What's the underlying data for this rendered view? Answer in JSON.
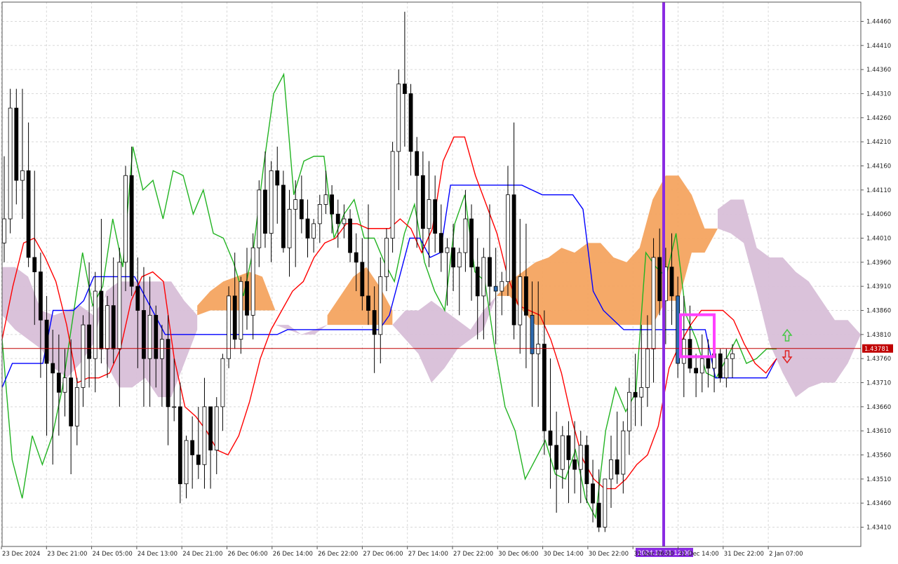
{
  "chart_data": {
    "type": "candlestick",
    "instrument": "",
    "colors": {
      "background": "#ffffff",
      "grid": "#d9d9d9",
      "axis": "#555555",
      "candle_body_bull": "#ffffff",
      "candle_body_bear": "#000000",
      "candle_body_bull_highlight": "#2e6bb0",
      "tenkan": "#ff0000",
      "kijun": "#0000ff",
      "chikou": "#22b322",
      "kumo_bull": "#f4a460",
      "kumo_bear": "#d8bfd8",
      "current_price": "#c00000",
      "vertical_marker": "#8a2be2",
      "highlight_box": "#ff40ff",
      "arrow_up": "#46c846",
      "arrow_down": "#e02020"
    },
    "y_range": [
      1.4337,
      1.445
    ],
    "y_ticks": [
      "1.44460",
      "1.44410",
      "1.44360",
      "1.44310",
      "1.44260",
      "1.44210",
      "1.44160",
      "1.44110",
      "1.44060",
      "1.44010",
      "1.43960",
      "1.43910",
      "1.43860",
      "1.43810",
      "1.43760",
      "1.43710",
      "1.43660",
      "1.43610",
      "1.43560",
      "1.43510",
      "1.43460",
      "1.43410"
    ],
    "x_tick_labels": [
      "23 Dec 2024",
      "23 Dec 21:00",
      "24 Dec 05:00",
      "24 Dec 13:00",
      "24 Dec 21:00",
      "26 Dec 06:00",
      "26 Dec 14:00",
      "26 Dec 22:00",
      "27 Dec 06:00",
      "27 Dec 14:00",
      "27 Dec 22:00",
      "30 Dec 06:00",
      "30 Dec 14:00",
      "30 Dec 22:00",
      "31 Dec 06:00",
      "31 Dec 14:00",
      "31 Dec 22:00",
      "2 Jan 07:00"
    ],
    "current_price_label": "1.43781",
    "current_price": 1.43781,
    "marker_label": "2024.12.31 12:00",
    "candles_ohlc": [
      [
        1.44,
        1.4418,
        1.4396,
        1.4405
      ],
      [
        1.4405,
        1.4432,
        1.4402,
        1.4428
      ],
      [
        1.4428,
        1.4432,
        1.4408,
        1.4413
      ],
      [
        1.4413,
        1.4432,
        1.4405,
        1.4415
      ],
      [
        1.4415,
        1.4425,
        1.4395,
        1.4397
      ],
      [
        1.4397,
        1.4415,
        1.4383,
        1.4394
      ],
      [
        1.4394,
        1.4398,
        1.4372,
        1.4384
      ],
      [
        1.4384,
        1.4389,
        1.436,
        1.4375
      ],
      [
        1.4375,
        1.4382,
        1.4354,
        1.4373
      ],
      [
        1.4373,
        1.4381,
        1.436,
        1.4369
      ],
      [
        1.4369,
        1.4378,
        1.4364,
        1.4372
      ],
      [
        1.4372,
        1.438,
        1.4352,
        1.4362
      ],
      [
        1.4362,
        1.4372,
        1.4358,
        1.437
      ],
      [
        1.437,
        1.4385,
        1.4366,
        1.4383
      ],
      [
        1.4383,
        1.4396,
        1.437,
        1.4376
      ],
      [
        1.4376,
        1.4394,
        1.4369,
        1.439
      ],
      [
        1.439,
        1.4405,
        1.4375,
        1.4378
      ],
      [
        1.4378,
        1.4389,
        1.4372,
        1.4387
      ],
      [
        1.4387,
        1.4397,
        1.4375,
        1.4378
      ],
      [
        1.4378,
        1.4399,
        1.4366,
        1.4396
      ],
      [
        1.4396,
        1.4416,
        1.439,
        1.4414
      ],
      [
        1.4414,
        1.442,
        1.4389,
        1.4391
      ],
      [
        1.4391,
        1.4397,
        1.4374,
        1.4386
      ],
      [
        1.4386,
        1.4395,
        1.4366,
        1.4376
      ],
      [
        1.4376,
        1.4393,
        1.4366,
        1.4385
      ],
      [
        1.4385,
        1.4387,
        1.437,
        1.4376
      ],
      [
        1.4376,
        1.4383,
        1.4366,
        1.438
      ],
      [
        1.438,
        1.4385,
        1.4358,
        1.4366
      ],
      [
        1.4366,
        1.4376,
        1.4363,
        1.4366
      ],
      [
        1.4366,
        1.4371,
        1.4346,
        1.435
      ],
      [
        1.435,
        1.436,
        1.4347,
        1.4359
      ],
      [
        1.4359,
        1.4364,
        1.4349,
        1.4356
      ],
      [
        1.4356,
        1.4366,
        1.4351,
        1.4354
      ],
      [
        1.4354,
        1.4372,
        1.4349,
        1.4366
      ],
      [
        1.4366,
        1.4366,
        1.4349,
        1.4357
      ],
      [
        1.4357,
        1.4368,
        1.4352,
        1.4366
      ],
      [
        1.4366,
        1.4377,
        1.4361,
        1.4376
      ],
      [
        1.4376,
        1.4391,
        1.4374,
        1.4389
      ],
      [
        1.4389,
        1.4398,
        1.4378,
        1.438
      ],
      [
        1.438,
        1.4393,
        1.4377,
        1.4392
      ],
      [
        1.4392,
        1.4399,
        1.4382,
        1.4385
      ],
      [
        1.4385,
        1.4402,
        1.438,
        1.4399
      ],
      [
        1.4399,
        1.4413,
        1.4395,
        1.4411
      ],
      [
        1.4411,
        1.4419,
        1.4399,
        1.4402
      ],
      [
        1.4402,
        1.4417,
        1.4396,
        1.4415
      ],
      [
        1.4415,
        1.442,
        1.4404,
        1.4412
      ],
      [
        1.4412,
        1.4415,
        1.4398,
        1.4399
      ],
      [
        1.4399,
        1.4411,
        1.4393,
        1.4407
      ],
      [
        1.4407,
        1.4413,
        1.4395,
        1.4409
      ],
      [
        1.4409,
        1.4414,
        1.4402,
        1.4405
      ],
      [
        1.4405,
        1.4409,
        1.4397,
        1.4401
      ],
      [
        1.4401,
        1.4405,
        1.4398,
        1.4404
      ],
      [
        1.4404,
        1.441,
        1.44,
        1.4408
      ],
      [
        1.4408,
        1.4415,
        1.4406,
        1.441
      ],
      [
        1.441,
        1.4412,
        1.4402,
        1.4406
      ],
      [
        1.4406,
        1.4409,
        1.4399,
        1.4404
      ],
      [
        1.4404,
        1.4408,
        1.4401,
        1.4405
      ],
      [
        1.4405,
        1.4407,
        1.4396,
        1.4398
      ],
      [
        1.4398,
        1.4402,
        1.439,
        1.4396
      ],
      [
        1.4396,
        1.4401,
        1.4386,
        1.4389
      ],
      [
        1.4389,
        1.4408,
        1.4383,
        1.4386
      ],
      [
        1.4386,
        1.4391,
        1.4373,
        1.4381
      ],
      [
        1.4381,
        1.4397,
        1.4375,
        1.4393
      ],
      [
        1.4393,
        1.4403,
        1.439,
        1.4401
      ],
      [
        1.4401,
        1.4421,
        1.4398,
        1.4419
      ],
      [
        1.4419,
        1.4436,
        1.4411,
        1.4433
      ],
      [
        1.4433,
        1.4448,
        1.442,
        1.4431
      ],
      [
        1.4431,
        1.4433,
        1.4414,
        1.4419
      ],
      [
        1.4419,
        1.4422,
        1.4399,
        1.4414
      ],
      [
        1.4414,
        1.4419,
        1.4398,
        1.4403
      ],
      [
        1.4403,
        1.4417,
        1.4395,
        1.4409
      ],
      [
        1.4409,
        1.4414,
        1.4398,
        1.4402
      ],
      [
        1.4402,
        1.4408,
        1.4394,
        1.4398
      ],
      [
        1.4398,
        1.4401,
        1.4387,
        1.4399
      ],
      [
        1.4399,
        1.4404,
        1.439,
        1.4395
      ],
      [
        1.4395,
        1.4399,
        1.4385,
        1.4398
      ],
      [
        1.4398,
        1.4411,
        1.4394,
        1.4405
      ],
      [
        1.4405,
        1.4408,
        1.4388,
        1.4395
      ],
      [
        1.4395,
        1.4401,
        1.438,
        1.4389
      ],
      [
        1.4389,
        1.4399,
        1.438,
        1.4397
      ],
      [
        1.4397,
        1.4408,
        1.4387,
        1.4391
      ],
      [
        1.4391,
        1.4399,
        1.4379,
        1.439
      ],
      [
        1.439,
        1.4394,
        1.4385,
        1.4392
      ],
      [
        1.4392,
        1.4416,
        1.4389,
        1.441
      ],
      [
        1.441,
        1.4425,
        1.438,
        1.4383
      ],
      [
        1.4383,
        1.4405,
        1.4377,
        1.4393
      ],
      [
        1.4393,
        1.4404,
        1.4374,
        1.4385
      ],
      [
        1.4385,
        1.4392,
        1.4366,
        1.4377
      ],
      [
        1.4377,
        1.4392,
        1.4366,
        1.4379
      ],
      [
        1.4379,
        1.4386,
        1.4356,
        1.4361
      ],
      [
        1.4361,
        1.4376,
        1.4349,
        1.4358
      ],
      [
        1.4358,
        1.4365,
        1.4344,
        1.4353
      ],
      [
        1.4353,
        1.4362,
        1.4349,
        1.436
      ],
      [
        1.436,
        1.4363,
        1.4346,
        1.4355
      ],
      [
        1.4355,
        1.4363,
        1.4348,
        1.4353
      ],
      [
        1.4353,
        1.4361,
        1.4346,
        1.4358
      ],
      [
        1.4358,
        1.436,
        1.4346,
        1.435
      ],
      [
        1.435,
        1.4355,
        1.4342,
        1.4346
      ],
      [
        1.4346,
        1.4353,
        1.434,
        1.4341
      ],
      [
        1.4341,
        1.4351,
        1.434,
        1.4351
      ],
      [
        1.4351,
        1.436,
        1.4345,
        1.4355
      ],
      [
        1.4355,
        1.4365,
        1.435,
        1.4352
      ],
      [
        1.4352,
        1.4363,
        1.4348,
        1.4361
      ],
      [
        1.4361,
        1.4372,
        1.4356,
        1.4369
      ],
      [
        1.4369,
        1.4377,
        1.4362,
        1.4368
      ],
      [
        1.4368,
        1.4383,
        1.4362,
        1.437
      ],
      [
        1.437,
        1.4385,
        1.4366,
        1.4378
      ],
      [
        1.4378,
        1.4401,
        1.4371,
        1.4397
      ],
      [
        1.4397,
        1.4403,
        1.4385,
        1.4388
      ],
      [
        1.4388,
        1.4399,
        1.4379,
        1.4395
      ],
      [
        1.4395,
        1.4402,
        1.4383,
        1.4389
      ],
      [
        1.4389,
        1.4393,
        1.4372,
        1.4375
      ],
      [
        1.4375,
        1.4389,
        1.4368,
        1.438
      ],
      [
        1.438,
        1.4387,
        1.4373,
        1.4374
      ],
      [
        1.4374,
        1.4377,
        1.4368,
        1.4373
      ],
      [
        1.4373,
        1.4381,
        1.4369,
        1.4376
      ],
      [
        1.4376,
        1.438,
        1.437,
        1.4374
      ],
      [
        1.4374,
        1.4378,
        1.4369,
        1.4377
      ],
      [
        1.4377,
        1.4378,
        1.4371,
        1.4372
      ],
      [
        1.4372,
        1.4378,
        1.437,
        1.4376
      ],
      [
        1.4376,
        1.4379,
        1.4372,
        1.4377
      ]
    ],
    "tenkan_sen": [
      1.438,
      1.4391,
      1.44,
      1.4401,
      1.4397,
      1.4392,
      1.4383,
      1.4371,
      1.4372,
      1.4372,
      1.4373,
      1.4378,
      1.4388,
      1.4393,
      1.4394,
      1.4392,
      1.4376,
      1.4366,
      1.4364,
      1.4361,
      1.4357,
      1.4356,
      1.436,
      1.4367,
      1.4376,
      1.4382,
      1.4386,
      1.439,
      1.4392,
      1.4397,
      1.44,
      1.4401,
      1.4404,
      1.4404,
      1.4403,
      1.4403,
      1.4403,
      1.4405,
      1.4403,
      1.4398,
      1.4403,
      1.4417,
      1.4422,
      1.4422,
      1.4414,
      1.4408,
      1.4402,
      1.4393,
      1.4387,
      1.4386,
      1.4385,
      1.438,
      1.4373,
      1.4363,
      1.4355,
      1.4351,
      1.4349,
      1.4349,
      1.4351,
      1.4354,
      1.4356,
      1.4362,
      1.4374,
      1.4379,
      1.4383,
      1.4386,
      1.4386,
      1.4386,
      1.4384,
      1.4379,
      1.4375,
      1.4373,
      1.4376
    ],
    "kijun_sen": [
      1.437,
      1.4375,
      1.4375,
      1.4375,
      1.4375,
      1.4386,
      1.4386,
      1.4386,
      1.4388,
      1.4393,
      1.4393,
      1.4393,
      1.4393,
      1.4393,
      1.4389,
      1.4385,
      1.4381,
      1.4381,
      1.4381,
      1.4381,
      1.4381,
      1.4381,
      1.4381,
      1.4381,
      1.4381,
      1.4381,
      1.4381,
      1.4381,
      1.4382,
      1.4382,
      1.4382,
      1.4382,
      1.4382,
      1.4382,
      1.4382,
      1.4382,
      1.4382,
      1.4382,
      1.4385,
      1.4393,
      1.4401,
      1.4401,
      1.4397,
      1.4398,
      1.4412,
      1.4412,
      1.4412,
      1.4412,
      1.4412,
      1.4412,
      1.4412,
      1.4412,
      1.4411,
      1.441,
      1.441,
      1.441,
      1.441,
      1.4407,
      1.439,
      1.4386,
      1.4384,
      1.4382,
      1.4382,
      1.4382,
      1.4382,
      1.4382,
      1.4382,
      1.4382,
      1.4382,
      1.4382,
      1.4372,
      1.4372,
      1.4372,
      1.4372,
      1.4372,
      1.4372,
      1.4376
    ],
    "chikou_span": [
      1.438,
      1.4355,
      1.4347,
      1.436,
      1.4354,
      1.436,
      1.437,
      1.4384,
      1.4398,
      1.4387,
      1.4391,
      1.4405,
      1.4395,
      1.442,
      1.4411,
      1.4413,
      1.4405,
      1.4415,
      1.4414,
      1.4406,
      1.4411,
      1.4402,
      1.4401,
      1.4396,
      1.4389,
      1.4399,
      1.4416,
      1.4431,
      1.4435,
      1.441,
      1.4417,
      1.4418,
      1.4418,
      1.4401,
      1.4406,
      1.4409,
      1.4401,
      1.4401,
      1.4396,
      1.4392,
      1.4402,
      1.4408,
      1.4396,
      1.439,
      1.4386,
      1.4404,
      1.441,
      1.4394,
      1.4392,
      1.4378,
      1.4366,
      1.4361,
      1.4351,
      1.4355,
      1.4359,
      1.4352,
      1.4351,
      1.4357,
      1.4347,
      1.4343,
      1.4361,
      1.437,
      1.4365,
      1.4369,
      1.4398,
      1.4395,
      1.4393,
      1.4402,
      1.4385,
      1.438,
      1.4373,
      1.4372,
      1.4376,
      1.438,
      1.4375,
      1.4376,
      1.4378,
      1.4378
    ],
    "kumo_segments": [
      {
        "type": "bear",
        "senkou_a": [
          1.4395,
          1.4395,
          1.4393,
          1.4386,
          1.4385,
          1.4386,
          1.4387,
          1.4385,
          1.4389
        ],
        "senkou_b": [
          1.4385,
          1.4382,
          1.438,
          1.4378,
          1.4374,
          1.4372,
          1.4375,
          1.4379,
          1.439
        ]
      },
      {
        "type": "bear",
        "senkou_a": [
          1.439,
          1.4392,
          1.4392,
          1.4392,
          1.4392,
          1.4392,
          1.4388,
          1.4385
        ],
        "senkou_b": [
          1.4375,
          1.437,
          1.437,
          1.4372,
          1.4368,
          1.4368,
          1.4375,
          1.4382
        ]
      },
      {
        "type": "bull",
        "senkou_a": [
          1.4387,
          1.439,
          1.4392,
          1.4393,
          1.4394,
          1.4393,
          1.4386
        ],
        "senkou_b": [
          1.4385,
          1.4386,
          1.4386,
          1.4386,
          1.4386,
          1.4386,
          1.4386
        ]
      },
      {
        "type": "bear",
        "senkou_a": [
          1.4383,
          1.4383,
          1.4381,
          1.4382,
          1.4383
        ],
        "senkou_b": [
          1.4383,
          1.4382,
          1.4381,
          1.4381,
          1.4383
        ]
      },
      {
        "type": "bull",
        "senkou_a": [
          1.4385,
          1.4389,
          1.4393,
          1.4395,
          1.4391,
          1.4386
        ],
        "senkou_b": [
          1.4383,
          1.4383,
          1.4383,
          1.4383,
          1.4383,
          1.4383
        ]
      },
      {
        "type": "bear",
        "senkou_a": [
          1.4383,
          1.4386,
          1.4386,
          1.4388,
          1.4386,
          1.4384,
          1.4382,
          1.4386,
          1.4389
        ],
        "senkou_b": [
          1.4383,
          1.438,
          1.4377,
          1.4371,
          1.4374,
          1.4378,
          1.438,
          1.4382,
          1.4389
        ]
      },
      {
        "type": "bull",
        "senkou_a": [
          1.4389,
          1.4392,
          1.4394,
          1.4396,
          1.4397,
          1.4399,
          1.4398,
          1.44,
          1.44,
          1.4397,
          1.4396,
          1.4399,
          1.4409,
          1.4414,
          1.4414,
          1.441,
          1.4403,
          1.4403
        ],
        "senkou_b": [
          1.4389,
          1.4389,
          1.4386,
          1.4383,
          1.4383,
          1.4383,
          1.4383,
          1.4383,
          1.4383,
          1.4383,
          1.4383,
          1.4383,
          1.4383,
          1.4388,
          1.4388,
          1.4398,
          1.4398,
          1.4403
        ]
      },
      {
        "type": "bear",
        "senkou_a": [
          1.4407,
          1.4409,
          1.4409,
          1.4399,
          1.4397,
          1.4397,
          1.4394,
          1.4392,
          1.4388,
          1.4384,
          1.4384,
          1.4381
        ],
        "senkou_b": [
          1.4403,
          1.4402,
          1.44,
          1.439,
          1.4379,
          1.4373,
          1.4368,
          1.437,
          1.4371,
          1.4371,
          1.4375,
          1.4381
        ]
      }
    ]
  }
}
